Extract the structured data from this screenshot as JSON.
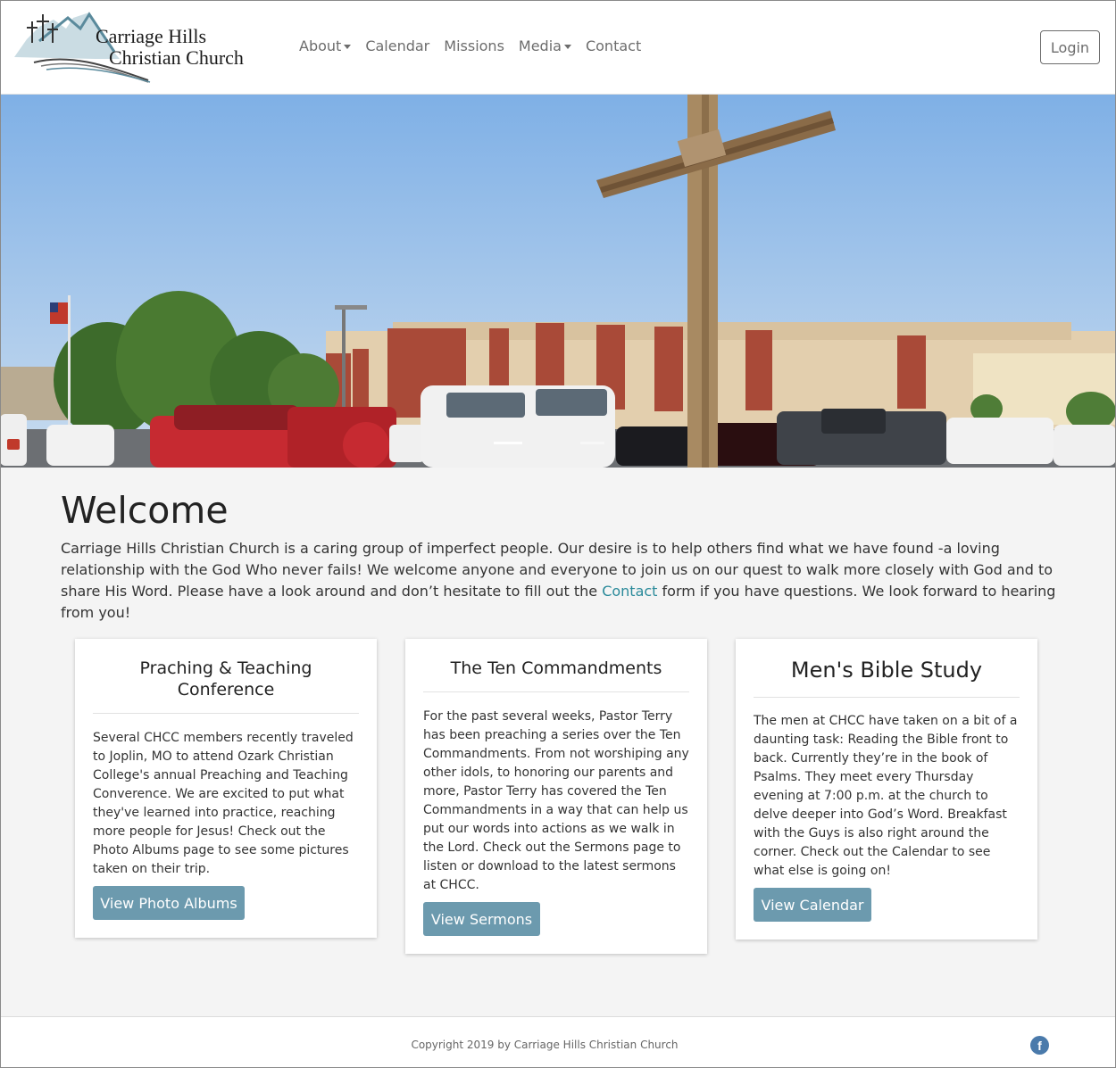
{
  "brand": {
    "line1": "Carriage Hills",
    "line2": "Christian Church"
  },
  "nav": {
    "items": [
      {
        "label": "About",
        "dropdown": true
      },
      {
        "label": "Calendar",
        "dropdown": false
      },
      {
        "label": "Missions",
        "dropdown": false
      },
      {
        "label": "Media",
        "dropdown": true
      },
      {
        "label": "Contact",
        "dropdown": false
      }
    ],
    "login_label": "Login"
  },
  "carousel": {
    "slide_count": 2,
    "active_slide": 1
  },
  "welcome": {
    "title": "Welcome",
    "text_before_link": "Carriage Hills Christian Church is a caring group of imperfect people. Our desire is to help others find what we have found -a loving relationship with the God Who never fails! We welcome anyone and everyone to join us on our quest to walk more closely with God and to share His Word. Please have a look around and don’t hesitate to fill out the ",
    "link_label": "Contact",
    "text_after_link": " form if you have questions. We look forward to hearing from you!"
  },
  "cards": [
    {
      "title": "Praching & Teaching Conference",
      "body": "Several CHCC members recently traveled to Joplin, MO to attend Ozark Christian College's annual Preaching and Teaching Converence. We are excited to put what they've learned into practice, reaching more people for Jesus! Check out the Photo Albums page to see some pictures taken on their trip.",
      "button": "View Photo Albums"
    },
    {
      "title": "The Ten Commandments",
      "body": "For the past several weeks, Pastor Terry has been preaching a series over the Ten Commandments. From not worshiping any other idols, to honoring our parents and more, Pastor Terry has covered the Ten Commandments in a way that can help us put our words into actions as we walk in the Lord. Check out the Sermons page to listen or download to the latest sermons at CHCC.",
      "button": "View Sermons"
    },
    {
      "title": "Men's Bible Study",
      "body": "The men at CHCC have taken on a bit of a daunting task: Reading the Bible front to back. Currently they’re in the book of Psalms. They meet every Thursday evening at 7:00 p.m. at the church to delve deeper into God’s Word. Breakfast with the Guys is also right around the corner. Check out the Calendar to see what else is going on!",
      "button": "View Calendar"
    }
  ],
  "footer": {
    "copyright": "Copyright 2019 by Carriage Hills Christian Church",
    "social_icon": "facebook-icon"
  },
  "colors": {
    "accent": "#6c9aae",
    "link": "#2a8a9a",
    "facebook": "#4a7aab"
  }
}
